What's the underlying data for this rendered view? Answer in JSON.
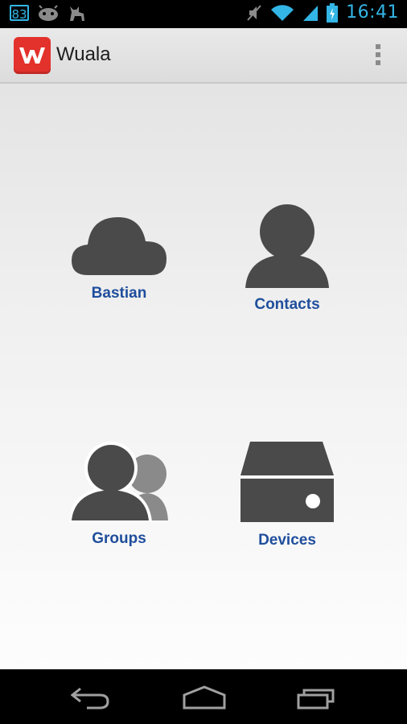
{
  "status_bar": {
    "notification_badge": "83",
    "time": "16:41",
    "icons": [
      "notification-count-icon",
      "android-debug-icon",
      "cat-icon",
      "mute-icon",
      "wifi-icon",
      "signal-icon",
      "battery-charging-icon"
    ]
  },
  "action_bar": {
    "app_name": "Wuala",
    "logo_letter": "W",
    "overflow_icon": "overflow-menu-icon"
  },
  "tiles": {
    "bastian": {
      "label": "Bastian",
      "icon": "cloud-icon"
    },
    "contacts": {
      "label": "Contacts",
      "icon": "person-icon"
    },
    "groups": {
      "label": "Groups",
      "icon": "group-icon"
    },
    "devices": {
      "label": "Devices",
      "icon": "drive-icon"
    }
  },
  "nav_bar": {
    "buttons": [
      "back-icon",
      "home-icon",
      "recent-apps-icon"
    ]
  },
  "colors": {
    "accent": "#33b5e5",
    "brand_red": "#e3312b",
    "label_blue": "#1f4e9c",
    "icon_gray": "#4a4a4a"
  }
}
